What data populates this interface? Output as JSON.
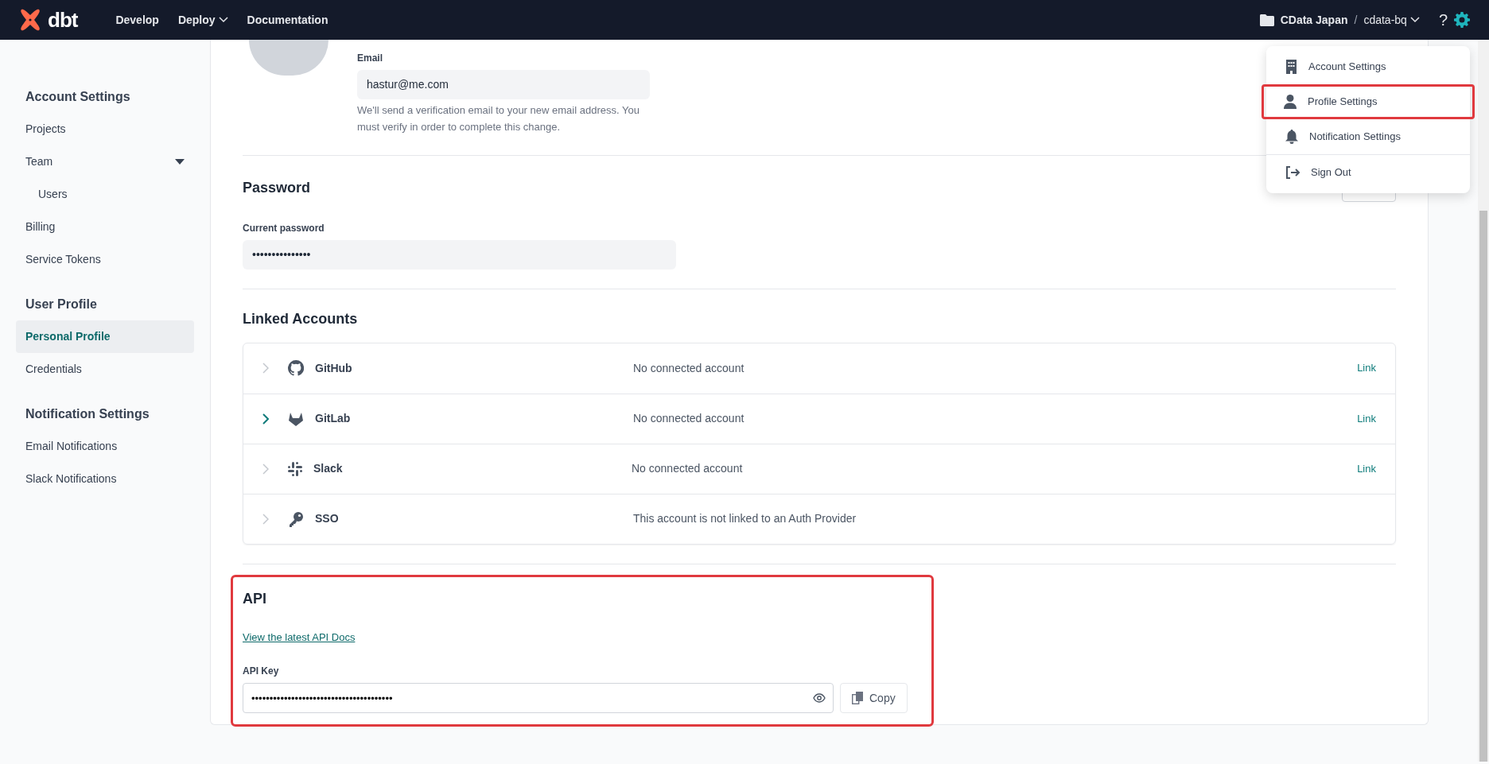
{
  "navbar": {
    "logo": "dbt",
    "links": [
      {
        "label": "Develop",
        "has_menu": false
      },
      {
        "label": "Deploy",
        "has_menu": true
      },
      {
        "label": "Documentation",
        "has_menu": false
      }
    ],
    "account": "CData Japan",
    "separator": "/",
    "project": "cdata-bq",
    "help": "?"
  },
  "sidebar": {
    "sections": [
      {
        "title": "Account Settings",
        "items": [
          {
            "label": "Projects",
            "selected": false
          },
          {
            "label": "Team",
            "selected": false,
            "expanded": true,
            "children": [
              {
                "label": "Users",
                "selected": false
              }
            ]
          },
          {
            "label": "Billing",
            "selected": false
          },
          {
            "label": "Service Tokens",
            "selected": false
          }
        ]
      },
      {
        "title": "User Profile",
        "items": [
          {
            "label": "Personal Profile",
            "selected": true
          },
          {
            "label": "Credentials",
            "selected": false
          }
        ]
      },
      {
        "title": "Notification Settings",
        "items": [
          {
            "label": "Email Notifications",
            "selected": false
          },
          {
            "label": "Slack Notifications",
            "selected": false
          }
        ]
      }
    ]
  },
  "email": {
    "label": "Email",
    "value": "hastur@me.com",
    "help": "We'll send a verification email to your new email address. You must verify in order to complete this change."
  },
  "password": {
    "title": "Password",
    "label": "Current password",
    "value": "•••••••••••••••"
  },
  "linked_accounts": {
    "title": "Linked Accounts",
    "rows": [
      {
        "kind": "github",
        "name": "GitHub",
        "status": "No connected account",
        "action": "Link",
        "hovered": false
      },
      {
        "kind": "gitlab",
        "name": "GitLab",
        "status": "No connected account",
        "action": "Link",
        "hovered": true
      },
      {
        "kind": "slack",
        "name": "Slack",
        "status": "No connected account",
        "action": "Link",
        "hovered": false
      },
      {
        "kind": "key",
        "name": "SSO",
        "status": "This account is not linked to an Auth Provider",
        "hovered": false
      }
    ]
  },
  "api": {
    "title": "API",
    "highlighted": true,
    "docs_link": "View the latest API Docs",
    "key_label": "API Key",
    "key_value": "•••••••••••••••••••••••••••••••••••••••",
    "copy": "Copy"
  },
  "menu": {
    "items": [
      {
        "kind": "building",
        "label": "Account Settings",
        "highlighted": false
      },
      {
        "kind": "person",
        "label": "Profile Settings",
        "highlighted": true
      },
      {
        "kind": "bell",
        "label": "Notification Settings",
        "highlighted": false
      },
      {
        "kind": "signout",
        "label": "Sign Out",
        "highlighted": false
      }
    ]
  }
}
